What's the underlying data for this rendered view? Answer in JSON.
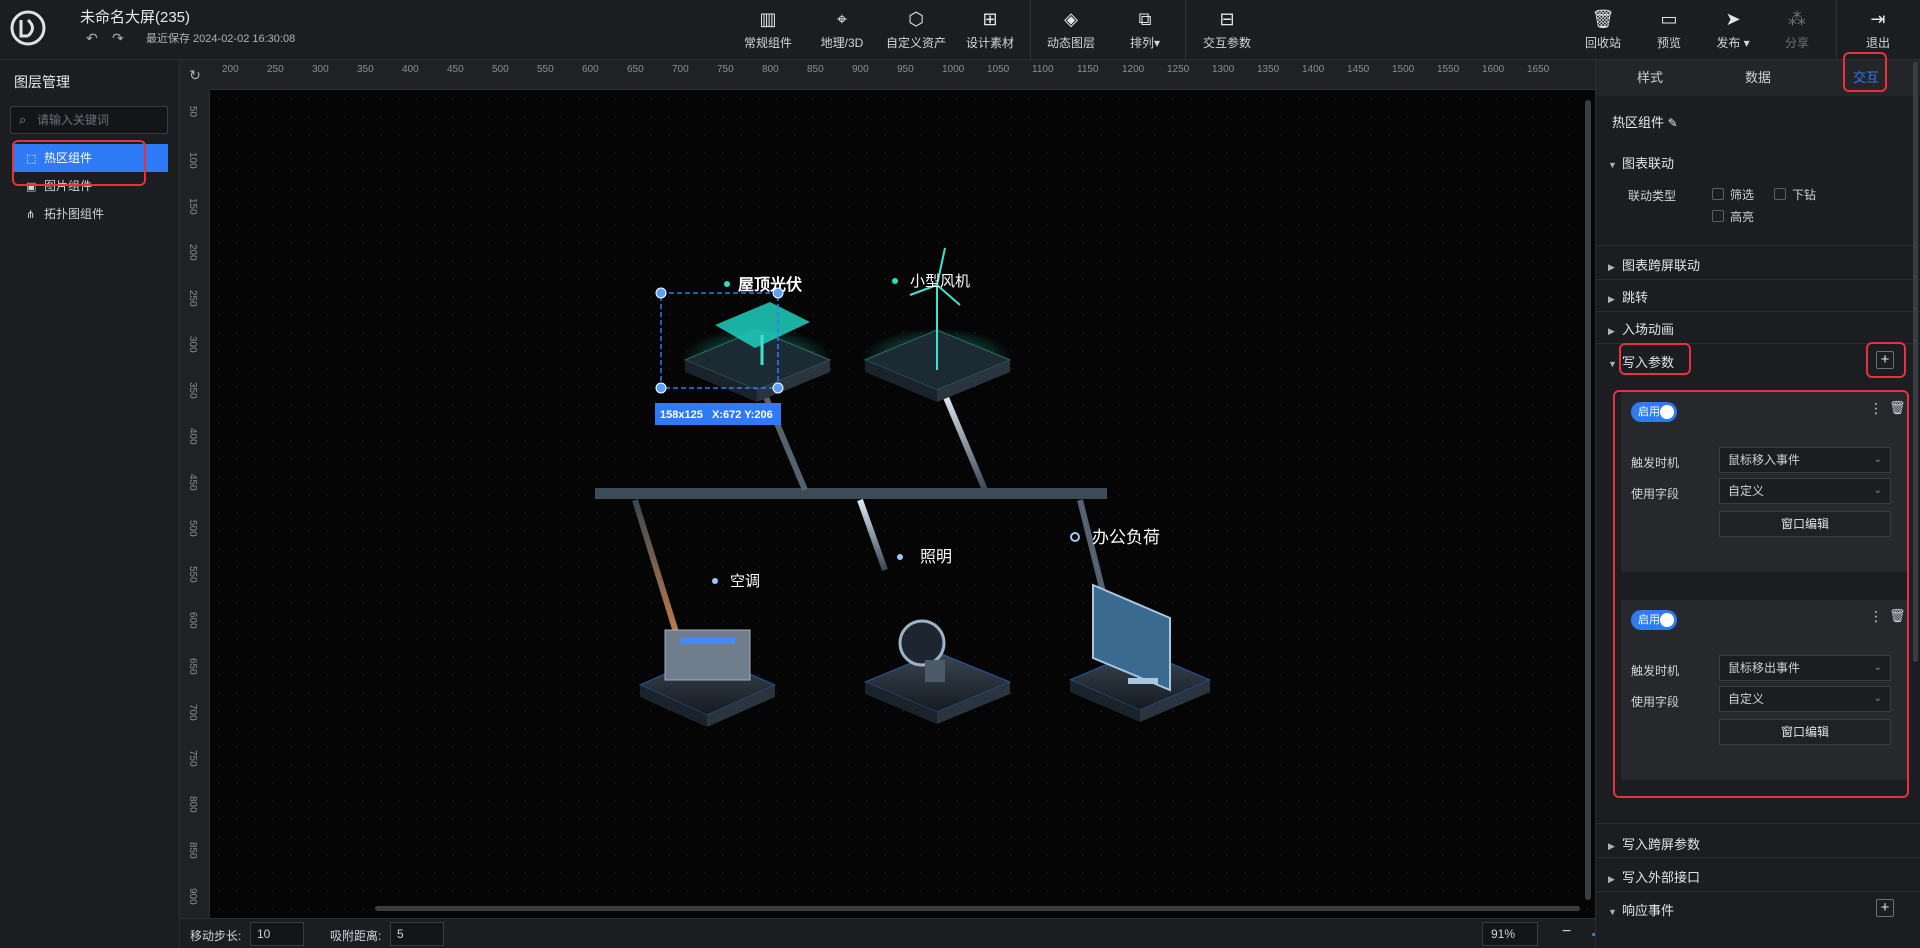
{
  "app": {
    "title": "未命名大屏(235)",
    "undo_icon": "undo-icon",
    "redo_icon": "redo-icon",
    "saved_text": "最近保存 2024-02-02 16:30:08"
  },
  "toolbar": {
    "center": [
      {
        "label": "常规组件",
        "icon": "bar-chart-icon"
      },
      {
        "label": "地理/3D",
        "icon": "map-pin-icon"
      },
      {
        "label": "自定义资产",
        "icon": "hexagon-icon"
      },
      {
        "label": "设计素材",
        "icon": "add-image-icon"
      },
      {
        "label": "动态图层",
        "icon": "layers-icon"
      },
      {
        "label": "排列▾",
        "icon": "arrange-icon"
      },
      {
        "label": "交互参数",
        "icon": "sliders-icon"
      }
    ],
    "right": [
      {
        "label": "回收站",
        "icon": "trash-can-icon"
      },
      {
        "label": "预览",
        "icon": "monitor-icon"
      },
      {
        "label": "发布 ▾",
        "icon": "send-icon"
      },
      {
        "label": "分享",
        "icon": "share-icon"
      },
      {
        "label": "退出",
        "icon": "exit-icon"
      }
    ]
  },
  "left_panel": {
    "title": "图层管理",
    "search_placeholder": "请输入关键词",
    "layers": [
      {
        "label": "热区组件",
        "icon": "hotspot-icon",
        "active": true
      },
      {
        "label": "图片组件",
        "icon": "image-icon",
        "active": false
      },
      {
        "label": "拓扑图组件",
        "icon": "topology-icon",
        "active": false
      }
    ]
  },
  "ruler": {
    "top": [
      "200",
      "250",
      "300",
      "350",
      "400",
      "450",
      "500",
      "550",
      "600",
      "650",
      "700",
      "750",
      "800",
      "850",
      "900",
      "950",
      "1000",
      "1050",
      "1100",
      "1150",
      "1200",
      "1250",
      "1300",
      "1350",
      "1400",
      "1450",
      "1500",
      "1550",
      "1600",
      "1650"
    ],
    "left": [
      "50",
      "100",
      "150",
      "200",
      "250",
      "300",
      "350",
      "400",
      "450",
      "500",
      "550",
      "600",
      "650",
      "700",
      "750",
      "800",
      "850",
      "900"
    ]
  },
  "canvas": {
    "nodes": [
      {
        "label": "屋顶光伏"
      },
      {
        "label": "小型风机"
      },
      {
        "label": "空调"
      },
      {
        "label": "照明"
      },
      {
        "label": "办公负荷"
      }
    ],
    "selection_info": "158x125   X:672 Y:206"
  },
  "bottom_bar": {
    "step_label": "移动步长:",
    "step_value": "10",
    "snap_label": "吸附距离:",
    "snap_value": "5",
    "zoom_value": "91%",
    "zoom_fraction": 0.35
  },
  "right_panel": {
    "tabs": [
      "样式",
      "数据",
      "交互"
    ],
    "active_tab": "交互",
    "component_name": "热区组件",
    "sections": {
      "chart_link": "图表联动",
      "link_type_label": "联动类型",
      "link_options": [
        "筛选",
        "下钻",
        "高亮"
      ],
      "cross_screen_link": "图表跨屏联动",
      "jump": "跳转",
      "entrance_anim": "入场动画",
      "write_params": "写入参数",
      "write_cross_params": "写入跨屏参数",
      "write_external": "写入外部接口",
      "response_events": "响应事件"
    },
    "param_cards": [
      {
        "toggle": "启用",
        "trigger_label": "触发时机",
        "trigger_value": "鼠标移入事件",
        "field_label": "使用字段",
        "field_value": "自定义",
        "edit_button": "窗口编辑"
      },
      {
        "toggle": "启用",
        "trigger_label": "触发时机",
        "trigger_value": "鼠标移出事件",
        "field_label": "使用字段",
        "field_value": "自定义",
        "edit_button": "窗口编辑"
      }
    ]
  }
}
